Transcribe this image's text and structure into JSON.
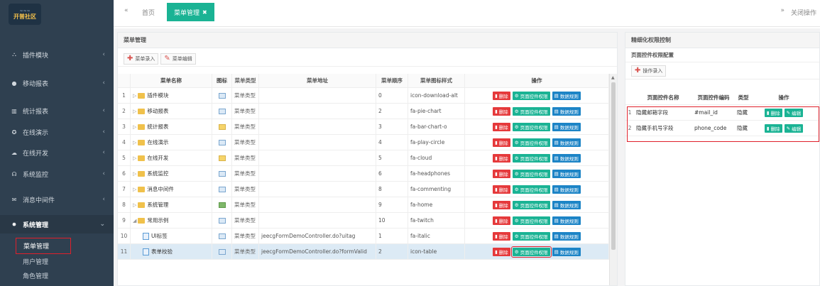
{
  "logo": {
    "line1": "开普社区"
  },
  "sidebar": {
    "items": [
      {
        "icon": "⛬",
        "label": "插件模块"
      },
      {
        "icon": "●",
        "label": "移动报表"
      },
      {
        "icon": "▥",
        "label": "统计报表"
      },
      {
        "icon": "✪",
        "label": "在线演示"
      },
      {
        "icon": "☁",
        "label": "在线开发"
      },
      {
        "icon": "☊",
        "label": "系统监控"
      },
      {
        "icon": "✉",
        "label": "消息中间件"
      },
      {
        "icon": "✸",
        "label": "系统管理"
      }
    ],
    "subitems": [
      {
        "label": "菜单管理"
      },
      {
        "label": "用户管理"
      },
      {
        "label": "角色管理"
      }
    ]
  },
  "tabs": {
    "back_icon": "«",
    "home": "首页",
    "menu": "菜单管理",
    "close_glyph": "✖",
    "fwd_icon": "»",
    "close_ops": "关闭操作"
  },
  "menu_panel": {
    "title": "菜单管理",
    "add_button": "菜单录入",
    "edit_button": "菜单编辑",
    "headers": {
      "name": "菜单名称",
      "icon": "图标",
      "type": "菜单类型",
      "url": "菜单地址",
      "order": "菜单顺序",
      "style": "菜单图标样式",
      "ops": "操作"
    },
    "btn_delete": "删除",
    "btn_perm": "页面控件权限",
    "btn_rule": "数据规则",
    "rows": [
      {
        "n": "1",
        "name": "插件模块",
        "type": "菜单类型",
        "url": "",
        "order": "0",
        "style": "icon-download-alt"
      },
      {
        "n": "2",
        "name": "移动报表",
        "type": "菜单类型",
        "url": "",
        "order": "2",
        "style": "fa-pie-chart"
      },
      {
        "n": "3",
        "name": "统计报表",
        "type": "菜单类型",
        "url": "",
        "order": "3",
        "style": "fa-bar-chart-o"
      },
      {
        "n": "4",
        "name": "在线演示",
        "type": "菜单类型",
        "url": "",
        "order": "4",
        "style": "fa-play-circle"
      },
      {
        "n": "5",
        "name": "在线开发",
        "type": "菜单类型",
        "url": "",
        "order": "5",
        "style": "fa-cloud"
      },
      {
        "n": "6",
        "name": "系统监控",
        "type": "菜单类型",
        "url": "",
        "order": "6",
        "style": "fa-headphones"
      },
      {
        "n": "7",
        "name": "消息中间件",
        "type": "菜单类型",
        "url": "",
        "order": "8",
        "style": "fa-commenting"
      },
      {
        "n": "8",
        "name": "系统管理",
        "type": "菜单类型",
        "url": "",
        "order": "9",
        "style": "fa-home"
      },
      {
        "n": "9",
        "name": "常用示例",
        "type": "菜单类型",
        "url": "",
        "order": "10",
        "style": "fa-twitch"
      },
      {
        "n": "10",
        "name": "UI标签",
        "type": "菜单类型",
        "url": "jeecgFormDemoController.do?uitag",
        "order": "1",
        "style": "fa-italic"
      },
      {
        "n": "11",
        "name": "表单校验",
        "type": "菜单类型",
        "url": "jeecgFormDemoController.do?formValid",
        "order": "2",
        "style": "icon-table"
      }
    ]
  },
  "perm_panel": {
    "title": "精细化权限控制",
    "subtitle": "页面控件权限配置",
    "add_button": "操作录入",
    "headers": {
      "name": "页面控件名称",
      "code": "页面控件编码",
      "type": "类型",
      "ops": "操作"
    },
    "btn_delete": "删除",
    "btn_edit": "编辑",
    "rows": [
      {
        "n": "1",
        "name": "隐藏邮箱字段",
        "code": "#mail_id",
        "type": "隐藏"
      },
      {
        "n": "2",
        "name": "隐藏手机号字段",
        "code": "phone_code",
        "type": "隐藏"
      }
    ]
  },
  "colors": {
    "sidebar_bg": "#2f4050",
    "accent": "#1ab394",
    "danger": "#e5393b",
    "info": "#1c84c6",
    "highlight": "#e0202b"
  }
}
